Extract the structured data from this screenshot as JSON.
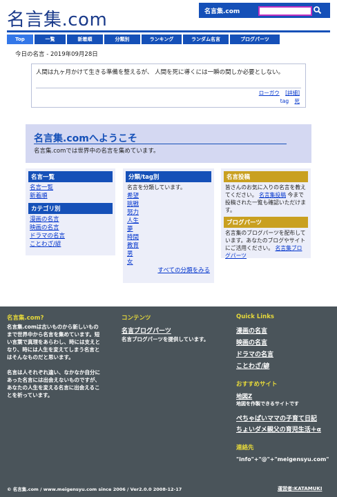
{
  "header": {
    "logo": "名言集.com",
    "site_name": "名言集.com",
    "search_value": ""
  },
  "nav": [
    "Top",
    "一覧",
    "新着順",
    "分類別",
    "ランキング",
    "ランダム名言",
    "ブログパーツ"
  ],
  "date_line": "今日の名言 - 2019年09月28日",
  "quote": {
    "text": "人間は九ヶ月かけて生きる準備を整えるが、 人間を死に導くには一瞬の間しか必要としない。",
    "link_aug": "ローガウ",
    "link_detail": "[詳細]",
    "tag_label": "tag",
    "tag_value": "死"
  },
  "welcome": {
    "title": "名言集.comへようこそ",
    "sub": "名言集.comでは世界中の名言を集めています。"
  },
  "col1": {
    "h1": "名言一覧",
    "items1": [
      "名言一覧",
      "新着順"
    ],
    "h2": "カテゴリ別",
    "items2": [
      "漫画の名言",
      "映画の名言",
      "ドラマの名言",
      "ことわざ/諺"
    ]
  },
  "col2": {
    "h": "分類/tag別",
    "desc": "名言を分類しています。",
    "items": [
      "希望",
      "挑戦",
      "努力",
      "人生",
      "夢",
      "時間",
      "教育",
      "男",
      "女"
    ],
    "more": "すべての分類をみる"
  },
  "col3": {
    "h1": "名言投稿",
    "p1a": "皆さんのお気に入りの名言を教えてください。",
    "p1link": "名言集投稿",
    "p1b": "今まで投稿された一覧も確認いただけます。",
    "h2": "ブログパーツ",
    "p2": "名言集のブログパーツを配布しています。あなたのブログやサイトにご活用ください。",
    "p2link": "名言集ブログパーツ"
  },
  "footer": {
    "about_h": "名言集.com?",
    "about_p1": "名言集.comは古いものから新しいものまで世界中から名言を集めています。短い言葉で真理をあらわし、時には支えとなり、時には人生を変えてしまう名言とはそんなものだと思います。",
    "about_p2": "名言は人それぞれ違い、なかなか自分にあった名言には出会えないものですが、あなたの人生を変える名言に出会えることを祈っています。",
    "contents_h": "コンテンツ",
    "contents_link": "名言ブログパーツ",
    "contents_desc": "名言ブログパーツを提供しています。",
    "quick_h": "Quick Links",
    "quick_links": [
      "漫画の名言",
      "映画の名言",
      "ドラマの名言",
      "ことわざ/諺"
    ],
    "recommend_h": "おすすめサイト",
    "rec1": "地図Z",
    "rec1_desc": "地図を作製できるサイトです",
    "rec2": "ぺちゃぱいママの子育て日記",
    "rec3": "ちょいダメ親父の育児生活＋α",
    "contact_h": "連絡先",
    "contact": "\"info\"+\"@\"+\"meigensyu.com\"",
    "copyright": "© 名言集.com / www.meigensyu.com since 2006 / Ver2.0.0 2008-12-17",
    "operator": "運営者:KATAMUKI"
  }
}
